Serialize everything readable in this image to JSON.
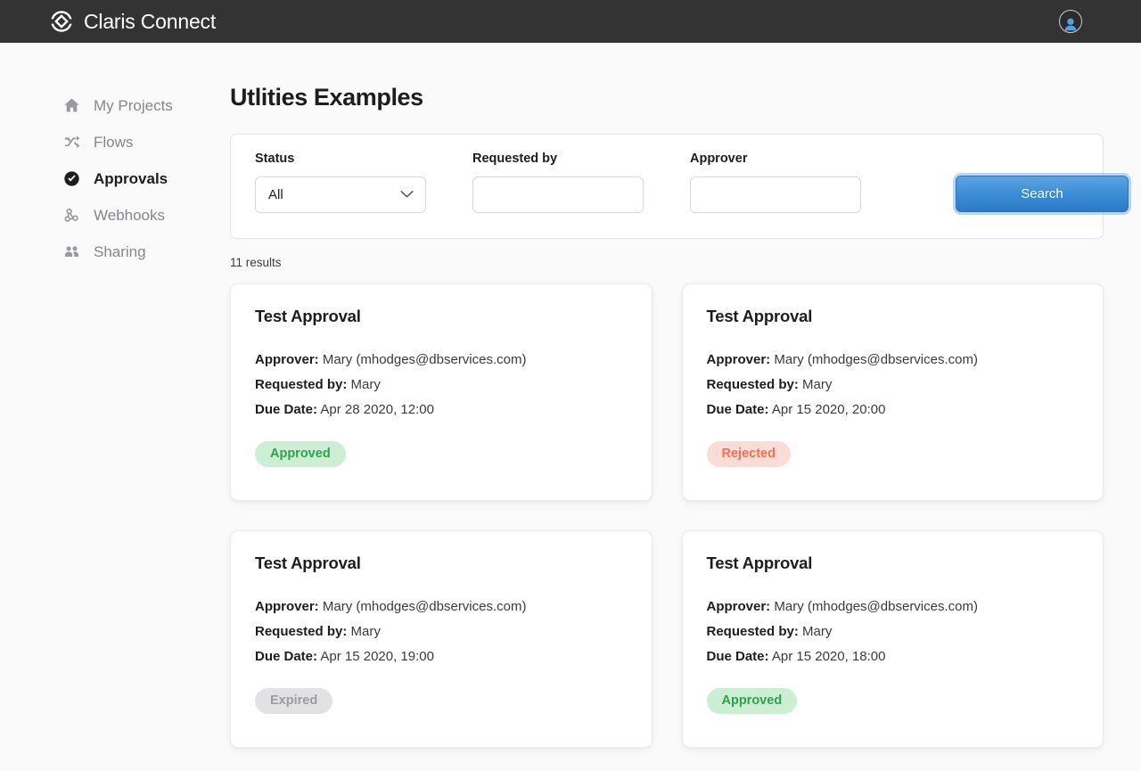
{
  "header": {
    "brand_name": "Claris Connect",
    "logo_icon": "claris-diamond-logo",
    "avatar_icon": "user-avatar-icon"
  },
  "sidebar": {
    "items": [
      {
        "label": "My Projects",
        "icon": "home-icon",
        "active": false
      },
      {
        "label": "Flows",
        "icon": "shuffle-icon",
        "active": false
      },
      {
        "label": "Approvals",
        "icon": "check-circle-icon",
        "active": true
      },
      {
        "label": "Webhooks",
        "icon": "webhook-icon",
        "active": false
      },
      {
        "label": "Sharing",
        "icon": "people-icon",
        "active": false
      }
    ]
  },
  "main": {
    "page_title": "Utlities Examples",
    "results_count": "11 results",
    "filters": {
      "status": {
        "label": "Status",
        "value": "All",
        "options": [
          "All"
        ],
        "chevron_icon": "chevron-down-icon"
      },
      "requested_by": {
        "label": "Requested by",
        "value": "",
        "placeholder": ""
      },
      "approver": {
        "label": "Approver",
        "value": "",
        "placeholder": ""
      },
      "search_label": "Search"
    },
    "field_labels": {
      "approver": "Approver:",
      "requested_by": "Requested by:",
      "due_date": "Due Date:"
    },
    "cards": [
      {
        "title": "Test Approval",
        "approver": "Mary (mhodges@dbservices.com)",
        "requested_by": "Mary",
        "due_date": "Apr 28 2020, 12:00",
        "status": "Approved",
        "status_key": "approved"
      },
      {
        "title": "Test Approval",
        "approver": "Mary (mhodges@dbservices.com)",
        "requested_by": "Mary",
        "due_date": "Apr 15 2020, 20:00",
        "status": "Rejected",
        "status_key": "rejected"
      },
      {
        "title": "Test Approval",
        "approver": "Mary (mhodges@dbservices.com)",
        "requested_by": "Mary",
        "due_date": "Apr 15 2020, 19:00",
        "status": "Expired",
        "status_key": "expired"
      },
      {
        "title": "Test Approval",
        "approver": "Mary (mhodges@dbservices.com)",
        "requested_by": "Mary",
        "due_date": "Apr 15 2020, 18:00",
        "status": "Approved",
        "status_key": "approved"
      }
    ]
  },
  "colors": {
    "header_bg": "#333333",
    "page_bg": "#fafafa",
    "accent_blue": "#3d8ed6",
    "approved": "#2fa04b",
    "approved_bg": "#ccefd3",
    "rejected": "#f0705a",
    "rejected_bg": "#fcdcd6",
    "expired": "#9c9ca0",
    "expired_bg": "#e2e2e4"
  }
}
